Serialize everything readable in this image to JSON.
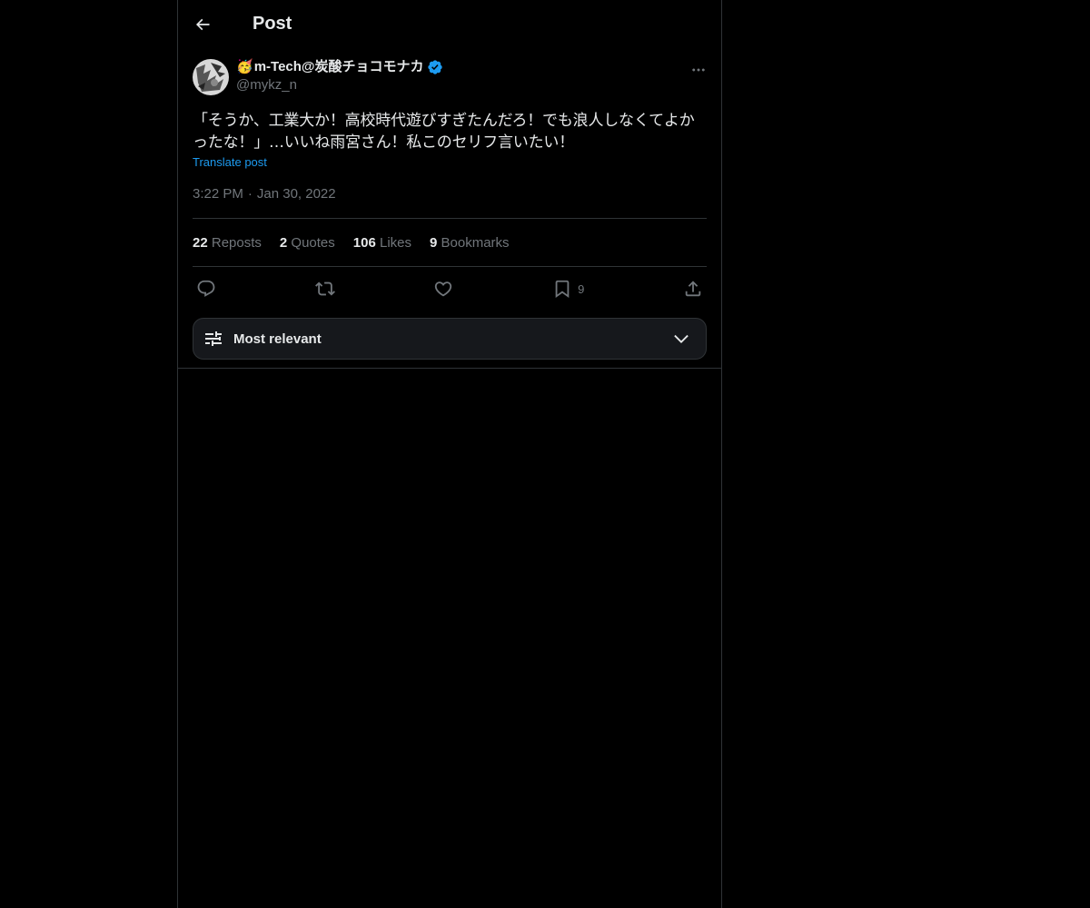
{
  "header": {
    "title": "Post"
  },
  "author": {
    "emoji": "🥳",
    "name": "m-Tech@炭酸チョコモナカ",
    "handle": "@mykz_n"
  },
  "post": {
    "text": "「そうか、工業大か！高校時代遊びすぎたんだろ！でも浪人しなくてよかったな！」…いいね雨宮さん！私このセリフ言いたい！",
    "translate_label": "Translate post",
    "time": "3:22 PM",
    "date": "Jan 30, 2022"
  },
  "stats": {
    "reposts_count": "22",
    "reposts_label": "Reposts",
    "quotes_count": "2",
    "quotes_label": "Quotes",
    "likes_count": "106",
    "likes_label": "Likes",
    "bookmarks_count": "9",
    "bookmarks_label": "Bookmarks"
  },
  "actions": {
    "bookmark_count": "9"
  },
  "sort": {
    "label": "Most relevant"
  },
  "colors": {
    "accent": "#1d9bf0",
    "background": "#000000",
    "muted": "#71767b"
  }
}
